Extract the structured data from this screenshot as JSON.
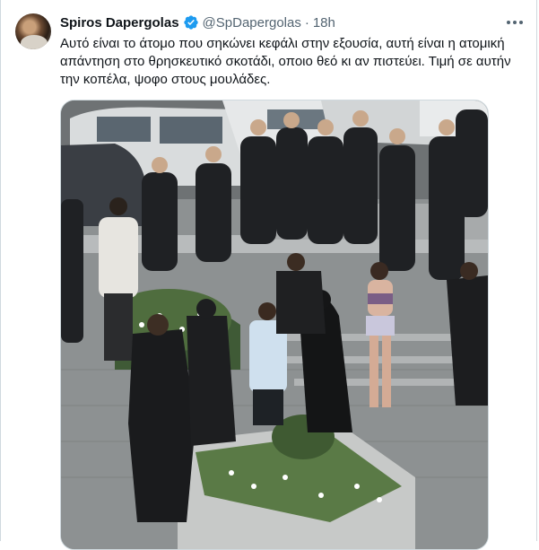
{
  "tweet": {
    "author_name": "Spiros Dapergolas",
    "handle": "@SpDapergolas",
    "separator": "·",
    "time": "18h",
    "text": "Αυτό είναι το άτομο που σηκώνει κεφάλι στην εξουσία, αυτή είναι η ατομική απάντηση στο θρησκευτικό σκοτάδι, οποιο θεό κι αν πιστεύει. Τιμή σε αυτήν την κοπέλα, ψοφο στους μουλάδες.",
    "verified": true
  },
  "icons": {
    "verified": "verified-badge-icon",
    "more": "more-options-icon"
  },
  "colors": {
    "verified_blue": "#1d9bf0",
    "secondary_text": "#536471",
    "border": "#cfd9de"
  }
}
